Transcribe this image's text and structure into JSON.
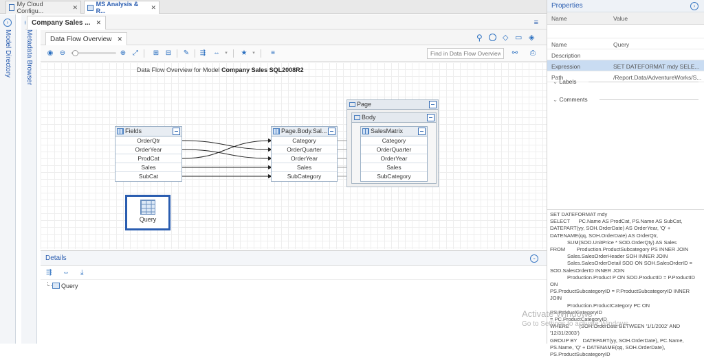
{
  "browser_tabs": [
    {
      "label": "My Cloud Configu...",
      "active": false
    },
    {
      "label": "MS Analysis & R...",
      "active": true
    }
  ],
  "left_rails": {
    "model_directory": "Model Directory",
    "metadata_browser": "Metadata Browser"
  },
  "doc_tab": {
    "label": "Company Sales ..."
  },
  "view_tab": {
    "label": "Data Flow Overview"
  },
  "toolbar": {
    "find_placeholder": "Find in Data Flow Overview"
  },
  "canvas": {
    "title_prefix": "Data Flow Overview for Model",
    "title_bold": "Company Sales SQL2008R2",
    "fields_table": {
      "title": "Fields",
      "rows": [
        "OrderQtr",
        "OrderYear",
        "ProdCat",
        "Sales",
        "SubCat"
      ]
    },
    "page_body_table": {
      "title": "Page.Body.Sal...",
      "rows": [
        "Category",
        "OrderQuarter",
        "OrderYear",
        "Sales",
        "SubCategory"
      ]
    },
    "page_group": "Page",
    "body_group": "Body",
    "sales_matrix": {
      "title": "SalesMatrix",
      "rows": [
        "Category",
        "OrderQuarter",
        "OrderYear",
        "Sales",
        "SubCategory"
      ]
    },
    "query_node": "Query"
  },
  "details": {
    "title": "Details",
    "tree_item": "Query"
  },
  "properties": {
    "title": "Properties",
    "col_name": "Name",
    "col_value": "Value",
    "rows": [
      {
        "name": "Name",
        "value": "Query"
      },
      {
        "name": "Description",
        "value": ""
      },
      {
        "name": "Expression",
        "value": "SET DATEFORMAT mdy SELE..."
      },
      {
        "name": "Path",
        "value": "/Report.Data/AdventureWorks/S..."
      }
    ],
    "labels_section": "Labels",
    "comments_section": "Comments",
    "sql": "SET DATEFORMAT mdy\nSELECT      PC.Name AS ProdCat, PS.Name AS SubCat,\nDATEPART(yy, SOH.OrderDate) AS OrderYear, 'Q' +\nDATENAME(qq, SOH.OrderDate) AS OrderQtr,\n            SUM(SOD.UnitPrice * SOD.OrderQty) AS Sales\nFROM        Production.ProductSubcategory PS INNER JOIN\n            Sales.SalesOrderHeader SOH INNER JOIN\n            Sales.SalesOrderDetail SOD ON SOH.SalesOrderID =\nSOD.SalesOrderID INNER JOIN\n            Production.Product P ON SOD.ProductID = P.ProductID ON\nPS.ProductSubcategoryID = P.ProductSubcategoryID INNER JOIN\n            Production.ProductCategory PC ON PS.ProductCategoryID\n= PC.ProductCategoryID\nWHERE       (SOH.OrderDate BETWEEN '1/1/2002' AND\n'12/31/2003')\nGROUP BY    DATEPART(yy, SOH.OrderDate), PC.Name,\nPS.Name, 'Q' + DATENAME(qq, SOH.OrderDate),\nPS.ProductSubcategoryID"
  },
  "watermark": {
    "line1": "Activate Windows",
    "line2": "Go to Settings to activate Windows."
  }
}
